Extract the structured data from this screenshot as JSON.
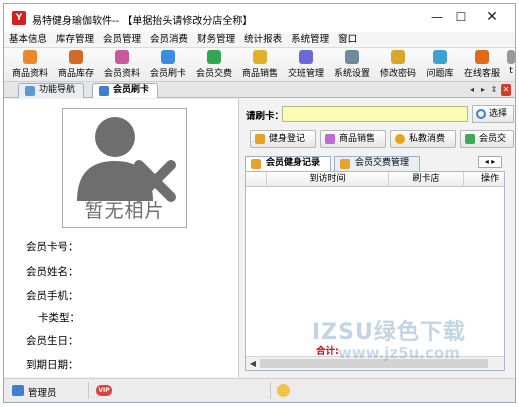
{
  "window": {
    "title": "易特健身瑜伽软件-- 【单据抬头请修改分店全称】",
    "logo_char": "Y",
    "controls": {
      "minimize": "—",
      "maximize": "☐",
      "close": "✕"
    }
  },
  "menu": [
    "基本信息",
    "库存管理",
    "会员管理",
    "会员消费",
    "财务管理",
    "统计报表",
    "系统管理",
    "窗口"
  ],
  "toolbar": [
    {
      "label": "商品资料",
      "icon": "box-icon",
      "color": "#e8892b"
    },
    {
      "label": "商品库存",
      "icon": "stock-icon",
      "color": "#d46a2a"
    },
    {
      "label": "会员资料",
      "icon": "member-icon",
      "color": "#c85a9a"
    },
    {
      "label": "会员刷卡",
      "icon": "card-icon",
      "color": "#3b8de0"
    },
    {
      "label": "会员交费",
      "icon": "pay-icon",
      "color": "#2fa84f"
    },
    {
      "label": "商品销售",
      "icon": "sales-icon",
      "color": "#e2b12c"
    },
    {
      "label": "交班管理",
      "icon": "shift-icon",
      "color": "#6a6ad8"
    },
    {
      "label": "系统设置",
      "icon": "settings-icon",
      "color": "#6f8a9c"
    },
    {
      "label": "修改密码",
      "icon": "password-icon",
      "color": "#d8a62a"
    },
    {
      "label": "问题库",
      "icon": "question-icon",
      "color": "#3ea1d6"
    },
    {
      "label": "在线客服",
      "icon": "support-icon",
      "color": "#e06a1a"
    },
    {
      "label": "t",
      "icon": "more-icon",
      "color": "#999999"
    }
  ],
  "tabs": [
    {
      "label": "功能导航",
      "active": false
    },
    {
      "label": "会员刷卡",
      "active": true
    }
  ],
  "tab_controls": {
    "prev": "◂",
    "next": "▸",
    "list": "⇕",
    "close": "✕"
  },
  "member": {
    "photo_placeholder": "暂无相片",
    "fields": [
      {
        "label": "会员卡号：",
        "value": ""
      },
      {
        "label": "会员姓名：",
        "value": ""
      },
      {
        "label": "会员手机：",
        "value": ""
      },
      {
        "label": "卡类型：",
        "value": ""
      },
      {
        "label": "会员生日：",
        "value": ""
      },
      {
        "label": "到期日期：",
        "value": ""
      }
    ]
  },
  "card": {
    "label": "请刷卡：",
    "value": "",
    "select_button": "选择"
  },
  "actions": [
    {
      "label": "健身登记",
      "icon": "fitness-icon",
      "color": "#e8a22a"
    },
    {
      "label": "商品销售",
      "icon": "cart-icon",
      "color": "#c06ad0"
    },
    {
      "label": "私教消费",
      "icon": "coach-icon",
      "color": "#e9a213"
    },
    {
      "label": "会员交",
      "icon": "pay-icon",
      "color": "#3fa85a"
    }
  ],
  "sub_tabs": [
    {
      "label": "会员健身记录",
      "active": true
    },
    {
      "label": "会员交费管理",
      "active": false
    }
  ],
  "grid": {
    "columns": [
      "",
      "到访时间",
      "刷卡店",
      "操作"
    ],
    "rows": [],
    "total_label": "合计:"
  },
  "statusbar": {
    "user": "管理员",
    "vip": "VIP"
  },
  "watermark": {
    "main": "IZSU绿色下载",
    "url": "www.jz5u.com"
  }
}
